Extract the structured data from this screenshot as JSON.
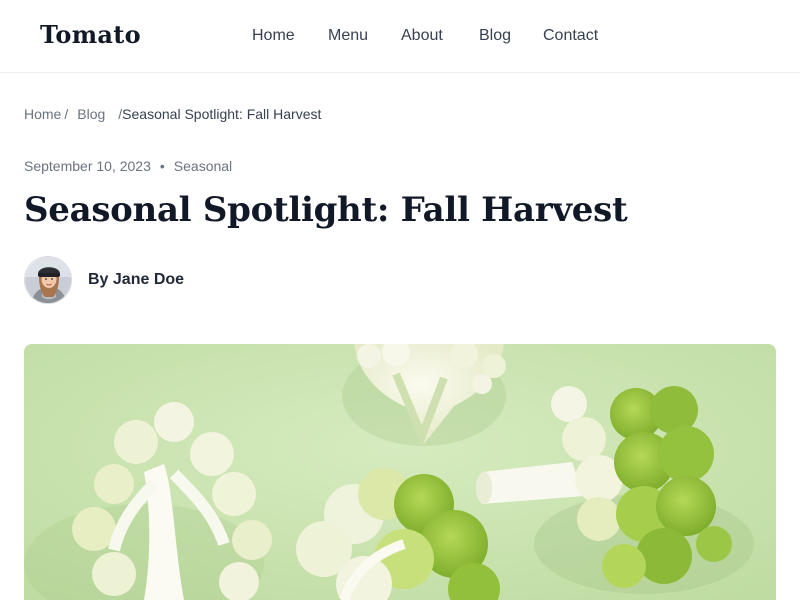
{
  "header": {
    "logo": "Tomato",
    "nav": [
      {
        "label": "Home"
      },
      {
        "label": "Menu"
      },
      {
        "label": "About"
      },
      {
        "label": "Blog"
      },
      {
        "label": "Contact"
      }
    ]
  },
  "breadcrumb": {
    "home": "Home",
    "sep1": "/",
    "blog": "Blog",
    "sep2": "/",
    "current": "Seasonal Spotlight: Fall Harvest"
  },
  "post": {
    "date": "September 10, 2023",
    "meta_separator": "•",
    "category": "Seasonal",
    "title": "Seasonal Spotlight: Fall Harvest",
    "author": "By Jane Doe"
  },
  "colors": {
    "text_dark": "#111827",
    "text_muted": "#6b7280",
    "image_background": "#cfe6b4"
  },
  "icons": {
    "avatar": "author-avatar-photo",
    "hero": "cauliflower-photo"
  }
}
